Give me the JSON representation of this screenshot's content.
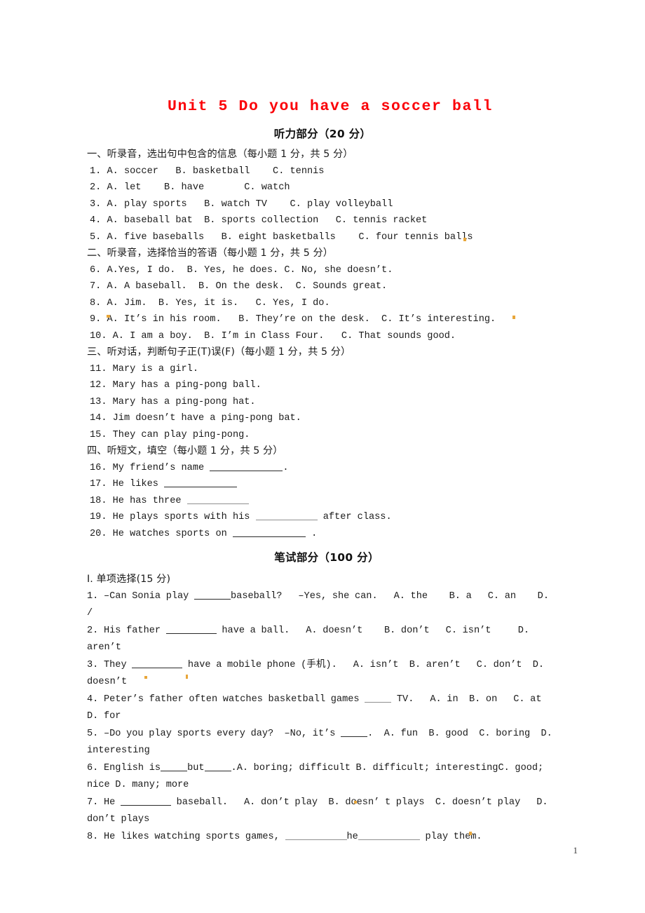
{
  "document": {
    "title": "Unit 5 Do you have a soccer ball",
    "title_color": "#fb0007",
    "page_number": "1"
  },
  "listening": {
    "header": "听力部分（20 分）",
    "sections": [
      {
        "heading": "一、听录音，选出句中包含的信息（每小题 1 分，共 5 分）",
        "questions": [
          "1. A. soccer   B. basketball    C. tennis",
          "2. A. let    B. have       C. watch",
          "3. A. play sports   B. watch TV    C. play volleyball",
          "4. A. baseball bat  B. sports collection   C. tennis racket",
          "5. A. five baseballs   B. eight basketballs    C. four tennis balls"
        ]
      },
      {
        "heading": "二、听录音，选择恰当的答语（每小题 1 分，共 5 分）",
        "questions": [
          "6. A.Yes, I do.  B. Yes, he does. C. No, she doesn’t.",
          "7. A. A baseball.  B. On the desk.  C. Sounds great.",
          "8. A. Jim.  B. Yes, it is.   C. Yes, I do.",
          "9. A. It’s in his room.   B. They’re on the desk.  C. It’s interesting.",
          "10. A. I am a boy.  B. I’m in Class Four.   C. That sounds good."
        ]
      },
      {
        "heading": "三、听对话，判断句子正(T)误(F)（每小题 1 分，共 5 分）",
        "questions": [
          "11. Mary is a girl.",
          "12. Mary has a ping-pong ball.",
          "13. Mary has a ping-pong hat.",
          "14. Jim doesn’t have a ping-pong bat.",
          "15. They can play ping-pong."
        ]
      },
      {
        "heading": "四、听短文，填空（每小题 1 分，共 5 分）",
        "fill_questions": [
          {
            "pre": "16. My friend’s name ",
            "blank": "b-xl",
            "post": "."
          },
          {
            "pre": "17. He likes ",
            "blank": "b-xl",
            "post": ""
          },
          {
            "pre": "18. He has three ",
            "blank": "b-l",
            "post": "",
            "dotted": true
          },
          {
            "pre": "19. He plays sports with his ",
            "blank": "b-l",
            "post": " after class.",
            "dotted": true
          },
          {
            "pre": "20. He watches sports on ",
            "blank": "b-xl",
            "post": " ."
          }
        ]
      }
    ]
  },
  "written": {
    "header": "笔试部分（100 分）",
    "section_heading": "I. 单项选择(15 分)",
    "questions": [
      {
        "pre": "1. –Can Sonia play ",
        "blank": "b-s",
        "post": "baseball?   –Yes, she can.   A. the    B. a   C. an    D. /"
      },
      {
        "pre": "2. His father ",
        "blank": "b-m",
        "post": " have a ball.   A. doesn’t    B. don’t   C. isn’t     D. aren’t"
      },
      {
        "pre": "3. They ",
        "blank": "b-m",
        "post": " have a mobile phone (手机).   A. isn’t  B. aren’t   C. don’t  D. doesn’t"
      },
      {
        "pre": "4. Peter’s father often watches basketball games ",
        "blank": "b-xs",
        "post": " TV.   A. in  B. on   C. at  D. for",
        "dotted": true
      },
      {
        "pre": "5. –Do you play sports every day?  –No, it’s ",
        "blank": "b-xs",
        "post": ".  A. fun  B. good  C. boring  D. interesting"
      },
      {
        "pre": "6. English is",
        "blank": "b-xs",
        "mid": "but",
        "blank2": "b-xs",
        "post": ".A. boring; difficult B. difficult; interestingC. good; nice D. many; more"
      },
      {
        "pre": "7. He ",
        "blank": "b-m",
        "post": " baseball.   A. don’t play  B. doesn’ t plays  C. doesn’t play   D. don’t plays"
      },
      {
        "pre": "8. He likes watching sports games, ",
        "blank": "b-l",
        "mid": "he",
        "blank2": "b-l",
        "post": " play them.",
        "dotted": true
      }
    ]
  }
}
